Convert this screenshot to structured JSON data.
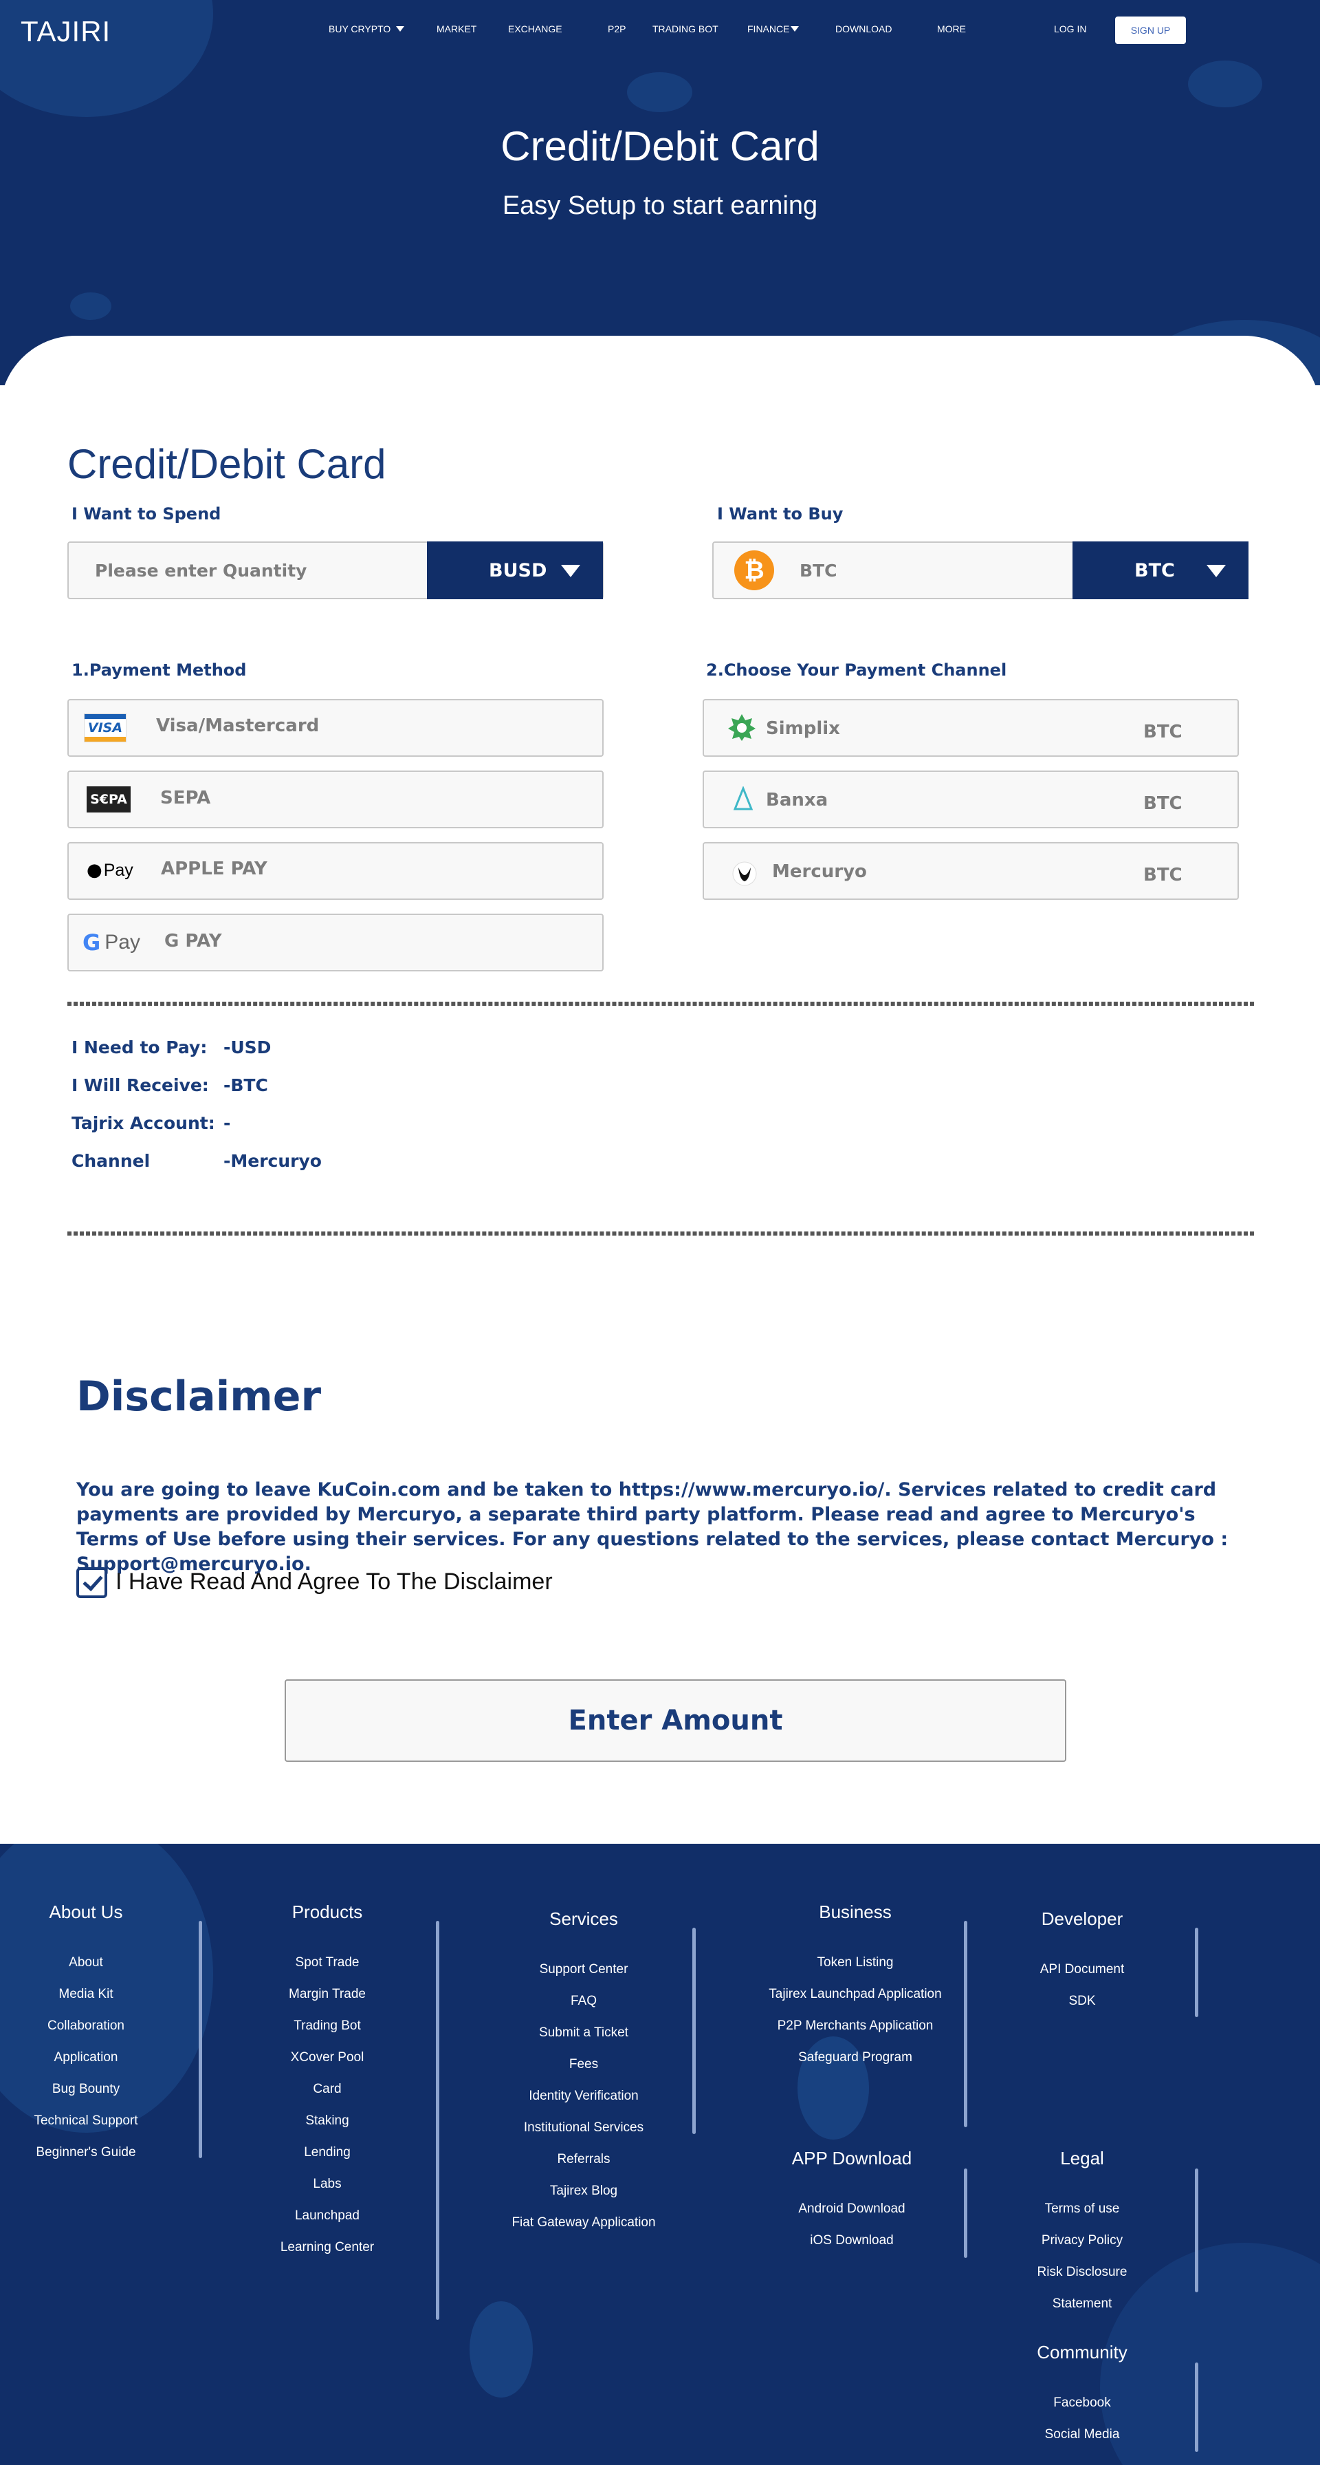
{
  "header": {
    "logo": "TAJIRI",
    "nav": [
      {
        "label": "BUY CRYPTO",
        "caret": true
      },
      {
        "label": "MARKET"
      },
      {
        "label": "EXCHANGE"
      },
      {
        "label": "P2P"
      },
      {
        "label": "TRADING BOT"
      },
      {
        "label": "FINANCE",
        "caret": true
      },
      {
        "label": "DOWNLOAD"
      },
      {
        "label": "MORE"
      }
    ],
    "login": "LOG IN",
    "signup": "SIGN UP"
  },
  "hero": {
    "title": "Credit/Debit Card",
    "subtitle": "Easy Setup to start earning"
  },
  "form": {
    "title": "Credit/Debit Card",
    "spend": {
      "label": "I Want to Spend",
      "placeholder": "Please enter Quantity",
      "currency": "BUSD"
    },
    "buy": {
      "label": "I Want to Buy",
      "value": "BTC",
      "currency": "BTC"
    },
    "payment_method": {
      "label": "1.Payment Method",
      "options": [
        {
          "icon": "visa-icon",
          "icon_text": "VISA",
          "label": "Visa/Mastercard"
        },
        {
          "icon": "sepa-icon",
          "icon_text": "S€PA",
          "label": "SEPA"
        },
        {
          "icon": "apple-pay-icon",
          "icon_text": "Pay",
          "label": "APPLE PAY"
        },
        {
          "icon": "google-pay-icon",
          "icon_text": "Pay",
          "label": "G PAY"
        }
      ]
    },
    "payment_channel": {
      "label": "2.Choose Your Payment Channel",
      "options": [
        {
          "icon": "simplex-icon",
          "label": "Simplix",
          "coin": "BTC"
        },
        {
          "icon": "banxa-icon",
          "label": "Banxa",
          "coin": "BTC"
        },
        {
          "icon": "mercuryo-icon",
          "label": "Mercuryo",
          "coin": "BTC"
        }
      ]
    },
    "summary": [
      {
        "key": "I Need to Pay:",
        "value": "-USD"
      },
      {
        "key": "I Will Receive:",
        "value": "-BTC"
      },
      {
        "key": "Tajrix Account:",
        "value": "-"
      },
      {
        "key": "Channel",
        "value": "-Mercuryo"
      }
    ]
  },
  "disclaimer": {
    "title": "Disclaimer",
    "text": "You are going to leave KuCoin.com and be taken to https://www.mercuryo.io/. Services related to credit card payments are provided by Mercuryo, a separate third party platform. Please read and agree to Mercuryo's Terms of Use before using their services. For any questions related to the services, please contact Mercuryo : Support@mercuryo.io.",
    "checkbox_label": "I Have Read And Agree To The Disclaimer",
    "checked": true,
    "button": "Enter Amount"
  },
  "footer": {
    "about": {
      "title": "About Us",
      "links": [
        "About",
        "Media Kit",
        "Collaboration",
        "Application",
        "Bug Bounty",
        "Technical Support",
        "Beginner's Guide"
      ]
    },
    "products": {
      "title": "Products",
      "links": [
        "Spot Trade",
        "Margin Trade",
        "Trading Bot",
        "XCover Pool",
        "Card",
        "Staking",
        "Lending",
        "Labs",
        "Launchpad",
        "Learning Center"
      ]
    },
    "services": {
      "title": "Services",
      "links": [
        "Support Center",
        "FAQ",
        "Submit a Ticket",
        "Fees",
        "Identity Verification",
        "Institutional Services",
        "Referrals",
        "Tajirex Blog",
        "Fiat Gateway Application"
      ]
    },
    "business": {
      "title": "Business",
      "links": [
        "Token Listing",
        "Tajirex Launchpad Application",
        "P2P Merchants Application",
        "Safeguard Program"
      ]
    },
    "app": {
      "title": "APP Download",
      "links": [
        "Android Download",
        "iOS Download"
      ]
    },
    "developer": {
      "title": "Developer",
      "links": [
        "API Document",
        "SDK"
      ]
    },
    "legal": {
      "title": "Legal",
      "links": [
        "Terms of use",
        "Privacy Policy",
        "Risk Disclosure",
        "Statement"
      ]
    },
    "community": {
      "title": "Community",
      "links": [
        "Facebook",
        "Social Media"
      ]
    }
  },
  "colors": {
    "navy": "#112e68",
    "heading": "#1a3c7a",
    "bitcoin": "#f7931a"
  }
}
